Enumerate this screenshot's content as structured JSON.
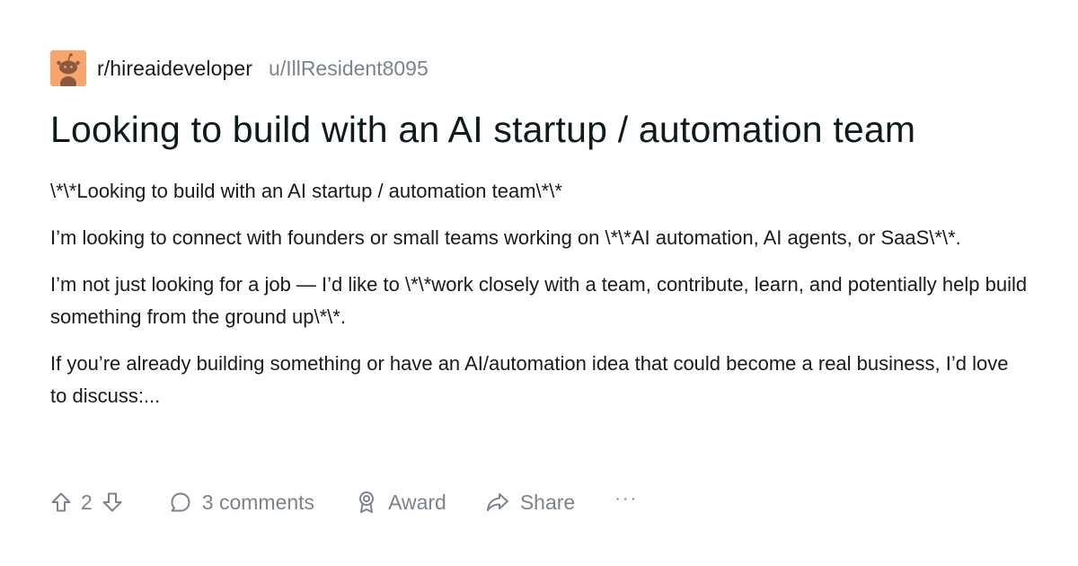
{
  "post": {
    "subreddit": "r/hireaideveloper",
    "username": "u/IllResident8095",
    "title": "Looking to build with an AI startup / automation team",
    "paragraphs": [
      "\\*\\*Looking to build with an AI startup / automation team\\*\\*",
      "I’m looking to connect with founders or small teams working on \\*\\*AI automation, AI agents, or SaaS\\*\\*.",
      "I’m not just looking for a job — I’d like to \\*\\*work closely with a team, contribute, learn, and potentially help build something from the ground up\\*\\*.",
      "If you’re already building something or have an AI/automation idea that could become a real business, I’d love to discuss:..."
    ]
  },
  "actions": {
    "vote_count": "2",
    "comments_label": "3 comments",
    "award_label": "Award",
    "share_label": "Share",
    "more_label": "···"
  },
  "icons": {
    "upvote": "upvote-arrow-icon",
    "downvote": "downvote-arrow-icon",
    "comment": "comment-bubble-icon",
    "award": "award-ribbon-icon",
    "share": "share-arrow-icon",
    "avatar": "snoo-avatar-icon"
  },
  "colors": {
    "avatar_bg": "#f6a56c",
    "muted_text": "#7b848c",
    "text": "#0f1a1c"
  }
}
